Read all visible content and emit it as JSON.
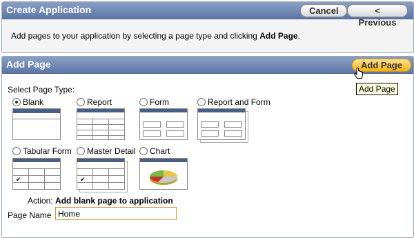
{
  "create_app": {
    "title": "Create Application",
    "cancel_label": "Cancel",
    "previous_label": "< Previous",
    "instruction_text": "Add pages to your application by selecting a page type and clicking ",
    "instruction_bold": "Add Page",
    "instruction_end": "."
  },
  "add_page": {
    "title": "Add Page",
    "button_label": "Add Page",
    "tooltip": "Add Page",
    "select_label": "Select Page Type:",
    "page_types": [
      "Blank",
      "Report",
      "Form",
      "Report and Form",
      "Tabular Form",
      "Master Detail",
      "Chart"
    ],
    "selected_type": "Blank",
    "action_label": "Action:",
    "action_value": "Add blank page to application",
    "page_name_label": "Page Name",
    "page_name_value": "Home"
  },
  "colors": {
    "header": "#5c76a6",
    "accent_button": "#f5b214"
  }
}
